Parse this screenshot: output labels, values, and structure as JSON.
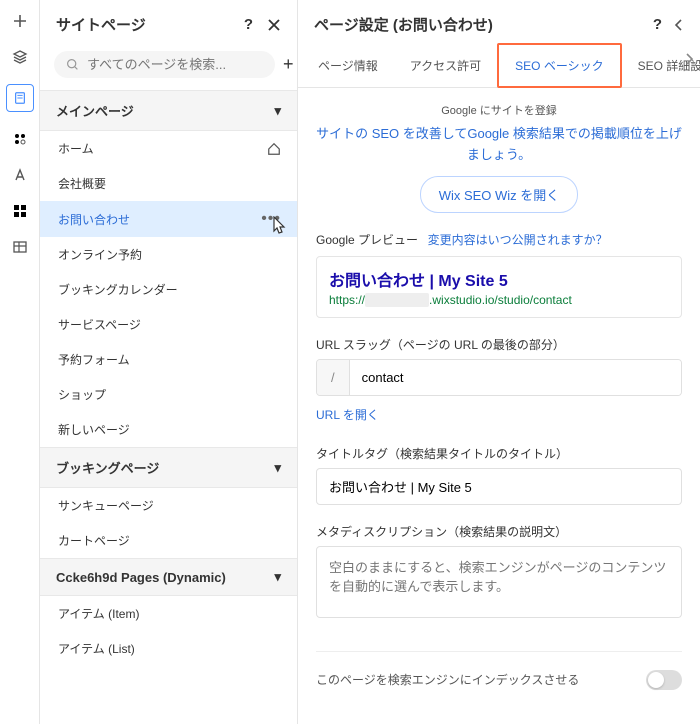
{
  "pagesPanel": {
    "title": "サイトページ",
    "searchPlaceholder": "すべてのページを検索...",
    "sections": [
      {
        "label": "メインページ",
        "items": [
          {
            "label": "ホーム",
            "home": true
          },
          {
            "label": "会社概要"
          },
          {
            "label": "お問い合わせ",
            "active": true
          },
          {
            "label": "オンライン予約"
          },
          {
            "label": "ブッキングカレンダー"
          },
          {
            "label": "サービスページ"
          },
          {
            "label": "予約フォーム"
          },
          {
            "label": "ショップ"
          },
          {
            "label": "新しいページ"
          }
        ]
      },
      {
        "label": "ブッキングページ",
        "items": [
          {
            "label": "サンキューページ"
          },
          {
            "label": "カートページ"
          }
        ]
      },
      {
        "label": "Ccke6h9d Pages (Dynamic)",
        "items": [
          {
            "label": "アイテム (Item)"
          },
          {
            "label": "アイテム (List)"
          }
        ]
      }
    ]
  },
  "settings": {
    "title": "ページ設定 (お問い合わせ)",
    "tabs": [
      "ページ情報",
      "アクセス許可",
      "SEO ベーシック",
      "SEO 詳細設定"
    ],
    "activeTab": 2,
    "registerText": "Google にサイトを登録",
    "improveText": "サイトの SEO を改善してGoogle 検索結果での掲載順位を上げましょう。",
    "wizButton": "Wix SEO Wiz を開く",
    "previewLabel": "Google プレビュー",
    "previewLink": "変更内容はいつ公開されますか？",
    "previewTitle": "お問い合わせ | My Site 5",
    "previewUrlPrefix": "https://",
    "previewUrlSuffix": ".wixstudio.io/studio/contact",
    "slugLabel": "URL スラッグ（ページの URL の最後の部分）",
    "slugValue": "contact",
    "openUrl": "URL を開く",
    "titleTagLabel": "タイトルタグ（検索結果タイトルのタイトル）",
    "titleTagValue": "お問い合わせ | My Site 5",
    "metaLabel": "メタディスクリプション（検索結果の説明文）",
    "metaPlaceholder": "空白のままにすると、検索エンジンがページのコンテンツを自動的に選んで表示します。",
    "indexLabel": "このページを検索エンジンにインデックスさせる"
  }
}
